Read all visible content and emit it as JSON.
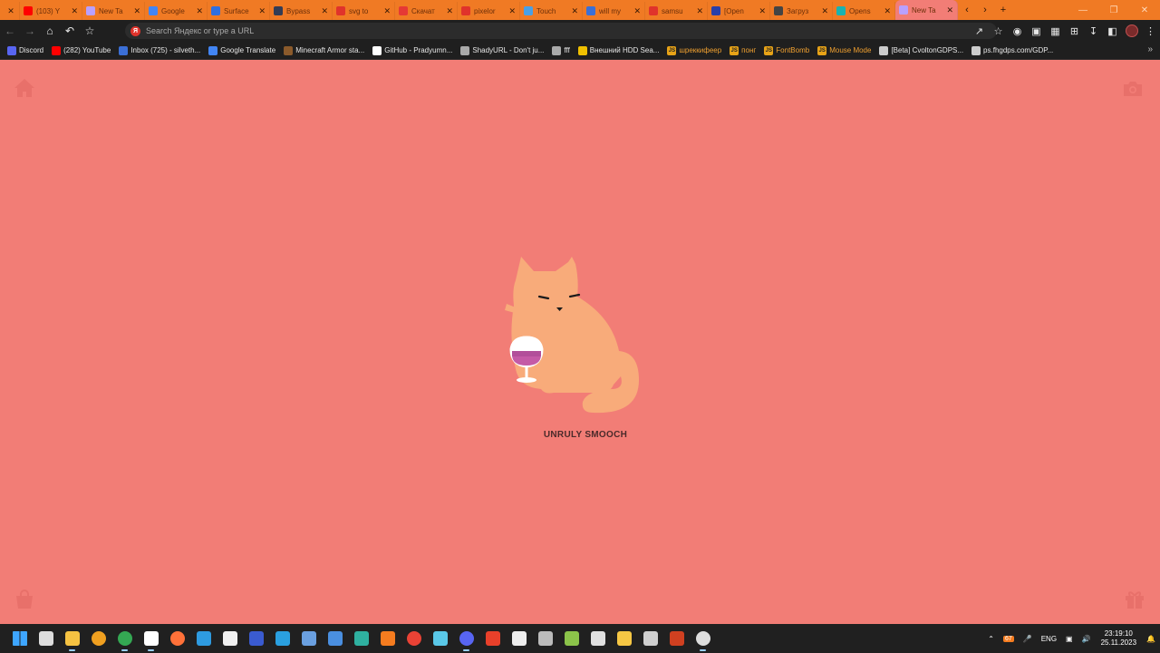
{
  "tabs": [
    {
      "label": "",
      "color": "#f07a24",
      "close_only": true
    },
    {
      "label": "(103) Y",
      "color": "#ff0000"
    },
    {
      "label": "New Ta",
      "color": "#b9a0ff"
    },
    {
      "label": "Google",
      "color": "#4285f4"
    },
    {
      "label": "Surface",
      "color": "#2f6fe0"
    },
    {
      "label": "Bypass",
      "color": "#333c55"
    },
    {
      "label": "svg to",
      "color": "#e0332b"
    },
    {
      "label": "Скачат",
      "color": "#e53935"
    },
    {
      "label": "pixelor",
      "color": "#e0332b"
    },
    {
      "label": "Touch",
      "color": "#4aa0e6"
    },
    {
      "label": "will my",
      "color": "#3b6fd6"
    },
    {
      "label": "samsu",
      "color": "#e0332b"
    },
    {
      "label": "[Open",
      "color": "#2a3fa8"
    },
    {
      "label": "Загруз",
      "color": "#444444"
    },
    {
      "label": "Opens",
      "color": "#19b3b0"
    },
    {
      "label": "New Ta",
      "color": "#b9a0ff",
      "active": true
    }
  ],
  "omnibox": {
    "placeholder": "Search Яндекс or type a URL"
  },
  "bookmarks": [
    {
      "label": "Discord",
      "color": "#5865f2"
    },
    {
      "label": "(282) YouTube",
      "color": "#ff0000"
    },
    {
      "label": "Inbox (725) - silveth...",
      "color": "#3b6fd6"
    },
    {
      "label": "Google Translate",
      "color": "#4285f4"
    },
    {
      "label": "Minecraft Armor sta...",
      "color": "#8b5a2b"
    },
    {
      "label": "GitHub - Pradyumn...",
      "color": "#ffffff"
    },
    {
      "label": "ShadyURL - Don't ju...",
      "color": "#aaaaaa"
    },
    {
      "label": "fff",
      "color": "#aaaaaa"
    },
    {
      "label": "Внешний HDD Sea...",
      "color": "#f0c000"
    },
    {
      "label": "шреккифеер",
      "color": "#e8a317",
      "js": true
    },
    {
      "label": "понг",
      "color": "#e8a317",
      "js": true
    },
    {
      "label": "FontBomb",
      "color": "#e8a317",
      "js": true
    },
    {
      "label": "Mouse Mode",
      "color": "#e8a317",
      "js": true
    },
    {
      "label": "[Beta] CvoltonGDPS...",
      "color": "#cccccc"
    },
    {
      "label": "ps.fhgdps.com/GDP...",
      "color": "#cccccc"
    }
  ],
  "page": {
    "caption": "UNRULY SMOOCH",
    "background": "#f27d76",
    "cat_color": "#f8ab7a"
  },
  "taskbar": {
    "apps": [
      {
        "name": "windows-start",
        "color": "#1e90ff"
      },
      {
        "name": "task-view",
        "color": "#dddddd"
      },
      {
        "name": "file-explorer",
        "color": "#f5c242",
        "running": true
      },
      {
        "name": "chrome-canary",
        "color": "#f0a020"
      },
      {
        "name": "chrome",
        "color": "#34a853",
        "running": true
      },
      {
        "name": "yandex-browser",
        "color": "#ffffff",
        "running": true
      },
      {
        "name": "firefox",
        "color": "#ff7139"
      },
      {
        "name": "app-w",
        "color": "#2e9be0"
      },
      {
        "name": "store",
        "color": "#f0f0f0"
      },
      {
        "name": "app-blue",
        "color": "#3a5bd0"
      },
      {
        "name": "shield",
        "color": "#2aa0e0"
      },
      {
        "name": "photos",
        "color": "#6aa0e0"
      },
      {
        "name": "app-round",
        "color": "#4a8fe0"
      },
      {
        "name": "app-teal",
        "color": "#2fb0a0"
      },
      {
        "name": "xampp",
        "color": "#f57c1f"
      },
      {
        "name": "chrome-2",
        "color": "#e94235"
      },
      {
        "name": "app-cube",
        "color": "#5ac8e8"
      },
      {
        "name": "discord",
        "color": "#5865f2",
        "running": true
      },
      {
        "name": "app-red",
        "color": "#e8402a"
      },
      {
        "name": "7zip",
        "color": "#eeeeee"
      },
      {
        "name": "app-grid",
        "color": "#bbbbbb"
      },
      {
        "name": "notepad",
        "color": "#8bc34a"
      },
      {
        "name": "paint",
        "color": "#e0e0e0"
      },
      {
        "name": "python",
        "color": "#f6c744"
      },
      {
        "name": "app-globe",
        "color": "#cfcfcf"
      },
      {
        "name": "app-tools",
        "color": "#d04020"
      },
      {
        "name": "obs",
        "color": "#dddddd",
        "running": true
      }
    ],
    "language": "ENG",
    "time": "23:19:10",
    "date": "25.11.2023",
    "tray_badge": "67"
  }
}
